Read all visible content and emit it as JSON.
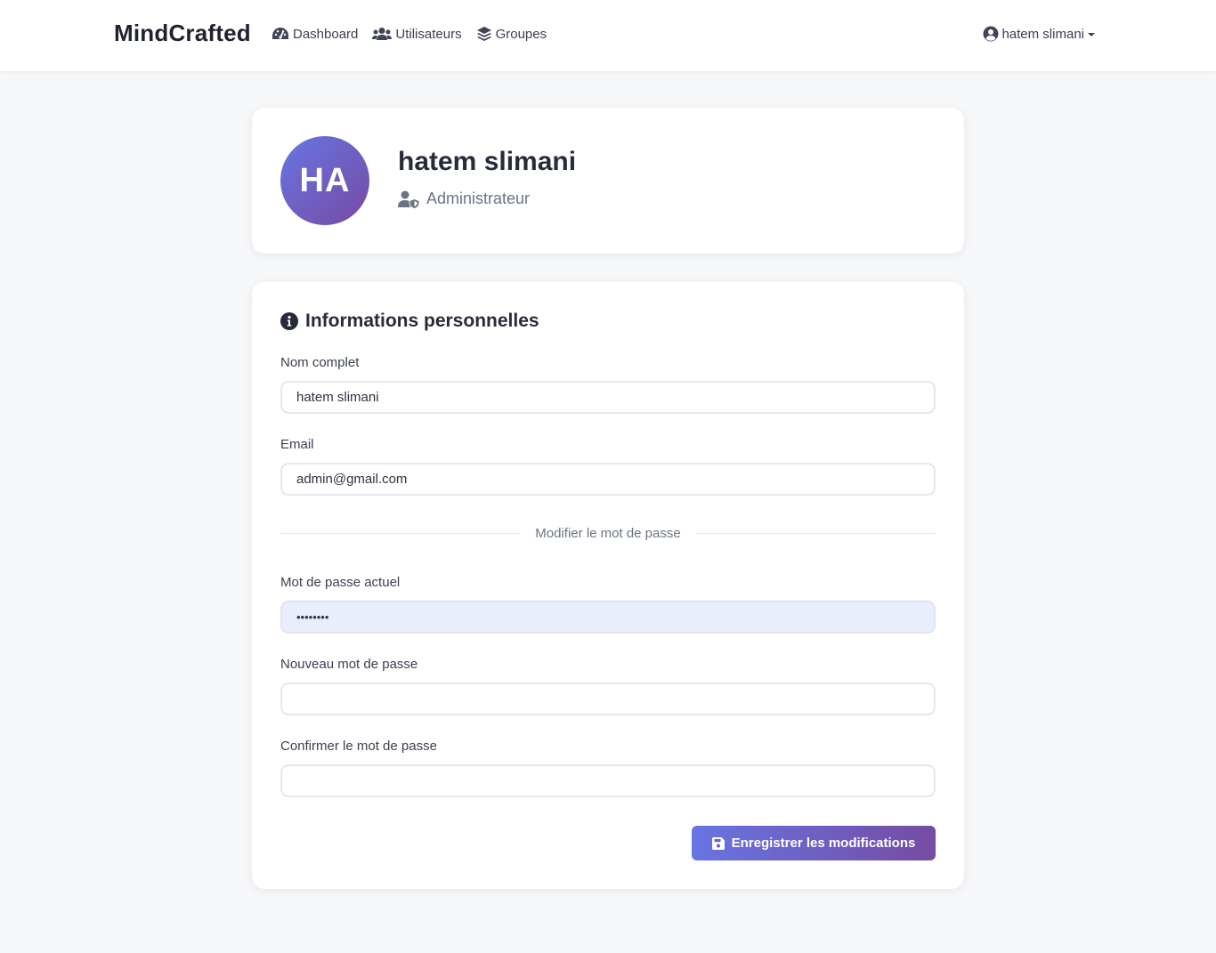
{
  "navbar": {
    "brand": "MindCrafted",
    "links": [
      {
        "label": "Dashboard",
        "icon": "gauge-icon"
      },
      {
        "label": "Utilisateurs",
        "icon": "users-icon"
      },
      {
        "label": "Groupes",
        "icon": "layers-icon"
      }
    ],
    "user": {
      "name": "hatem slimani",
      "icon": "user-circle-icon"
    }
  },
  "profile": {
    "initials": "HA",
    "name": "hatem slimani",
    "role": "Administrateur",
    "role_icon": "user-shield-icon"
  },
  "form": {
    "title": "Informations personnelles",
    "title_icon": "info-circle-icon",
    "full_name": {
      "label": "Nom complet",
      "value": "hatem slimani"
    },
    "email": {
      "label": "Email",
      "value": "admin@gmail.com"
    },
    "password_section": "Modifier le mot de passe",
    "current_password": {
      "label": "Mot de passe actuel",
      "value": "••••••••"
    },
    "new_password": {
      "label": "Nouveau mot de passe",
      "value": ""
    },
    "confirm_password": {
      "label": "Confirmer le mot de passe",
      "value": ""
    },
    "save_button": {
      "label": "Enregistrer les modifications",
      "icon": "save-icon"
    }
  },
  "colors": {
    "accent_start": "#6775e3",
    "accent_end": "#764ba2",
    "page_background": "#f6f7f9",
    "autofill_background": "#e8effb"
  }
}
